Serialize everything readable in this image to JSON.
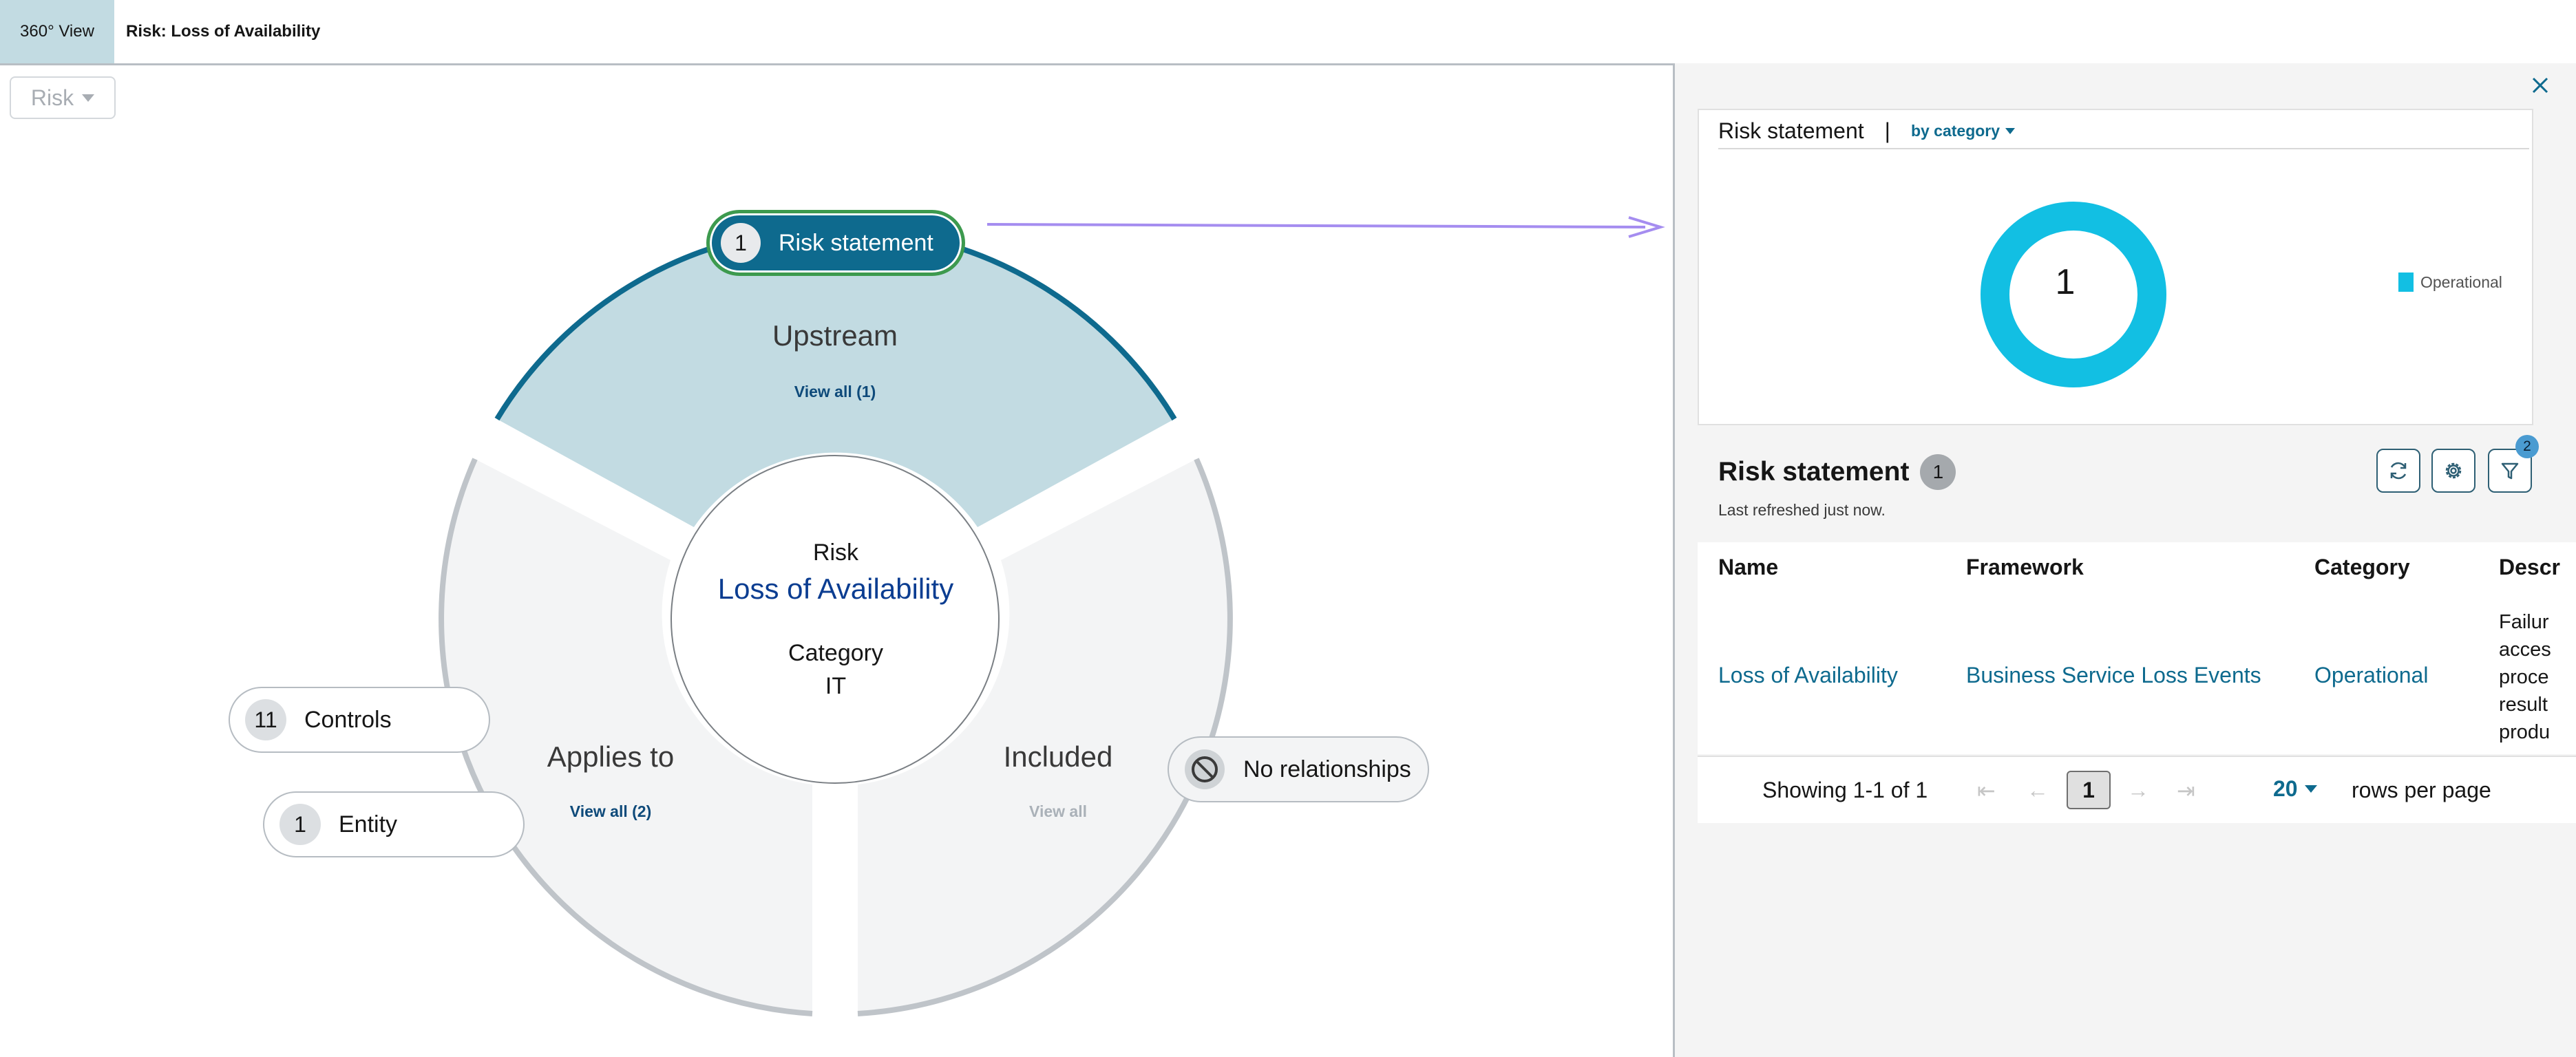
{
  "topbar": {
    "tab_label": "360° View",
    "breadcrumb": "Risk: Loss of Availability"
  },
  "filter_dropdown": {
    "value": "Risk"
  },
  "diagram": {
    "center": {
      "type_label": "Risk",
      "name": "Loss of Availability",
      "category_label": "Category",
      "category_value": "IT"
    },
    "upstream": {
      "title": "Upstream",
      "view_all": "View all (1)"
    },
    "applies_to": {
      "title": "Applies to",
      "view_all": "View all (2)"
    },
    "included": {
      "title": "Included",
      "view_all": "View all"
    },
    "pills": {
      "risk_statement": {
        "count": "1",
        "label": "Risk statement"
      },
      "controls": {
        "count": "11",
        "label": "Controls"
      },
      "entity": {
        "count": "1",
        "label": "Entity"
      },
      "no_relationships": {
        "label": "No relationships"
      }
    },
    "colors": {
      "upstream_fill": "#c2dbe2",
      "upstream_arc": "#0e6a8e",
      "segment_fill": "#f3f4f5",
      "segment_arc": "#bfc4c9",
      "arrow": "#a58df0"
    }
  },
  "panel": {
    "chart": {
      "title": "Risk statement",
      "separator": "|",
      "group_by": "by category",
      "center_value": "1",
      "legend": [
        {
          "label": "Operational",
          "color": "#12bfe3"
        }
      ]
    },
    "chart_data": {
      "type": "pie",
      "categories": [
        "Operational"
      ],
      "values": [
        1
      ],
      "title": "Risk statement"
    },
    "table_header": {
      "title": "Risk statement",
      "count": "1",
      "refreshed": "Last refreshed just now.",
      "filter_count": "2"
    },
    "table": {
      "columns": [
        "Name",
        "Framework",
        "Category",
        "Descr"
      ],
      "rows": [
        {
          "name": "Loss of Availability",
          "framework": "Business Service Loss Events",
          "category": "Operational",
          "description": [
            "Failur",
            "acces",
            "proce",
            "result",
            "produ"
          ]
        }
      ]
    },
    "pagination": {
      "showing": "Showing 1-1 of 1",
      "page": "1",
      "rows_per_page_value": "20",
      "rows_per_page_label": "rows per page"
    }
  }
}
